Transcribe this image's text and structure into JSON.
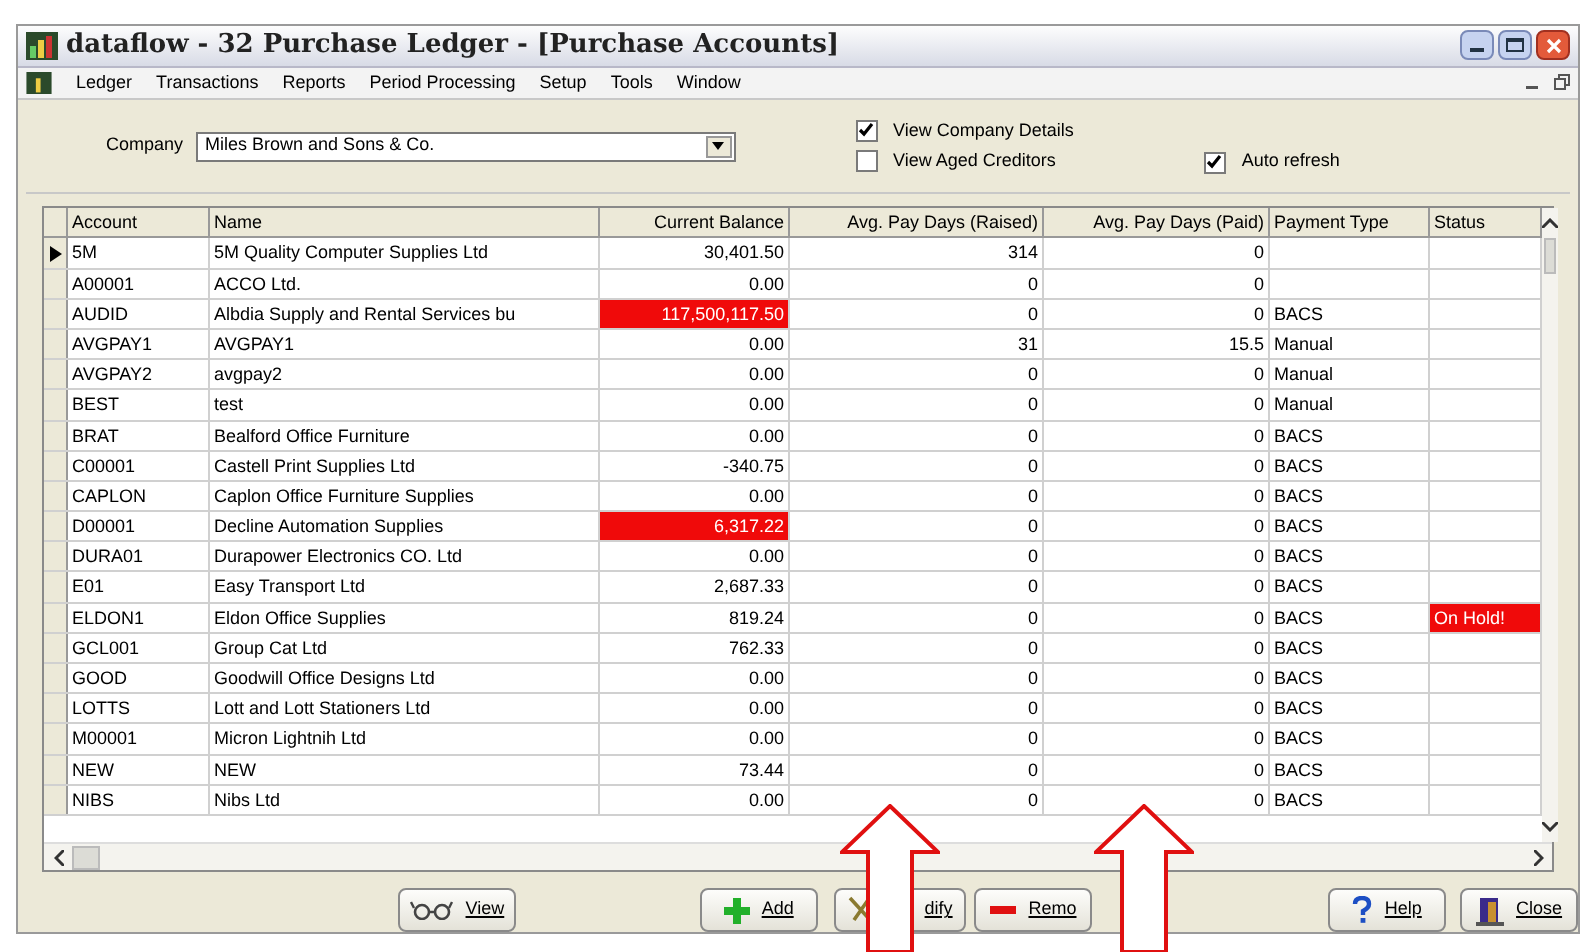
{
  "window": {
    "title": "dataflow - 32 Purchase Ledger - [Purchase Accounts]"
  },
  "menu": [
    "Ledger",
    "Transactions",
    "Reports",
    "Period Processing",
    "Setup",
    "Tools",
    "Window"
  ],
  "company": {
    "label": "Company",
    "value": "Miles Brown and Sons & Co."
  },
  "options": [
    {
      "label": "View Company Details",
      "checked": true
    },
    {
      "label": "View Aged Creditors",
      "checked": false
    },
    {
      "label": "Auto refresh",
      "checked": true
    }
  ],
  "table": {
    "columns": [
      "Account",
      "Name",
      "Current Balance",
      "Avg. Pay Days (Raised)",
      "Avg. Pay Days (Paid)",
      "Payment Type",
      "Status"
    ],
    "rows": [
      {
        "selected": true,
        "cells": [
          "5M",
          "5M Quality Computer Supplies Ltd",
          "30,401.50",
          "314",
          "0",
          "",
          ""
        ],
        "balance_alert": false,
        "status_alert": false
      },
      {
        "selected": false,
        "cells": [
          "A00001",
          "ACCO Ltd.",
          "0.00",
          "0",
          "0",
          "",
          ""
        ],
        "balance_alert": false,
        "status_alert": false
      },
      {
        "selected": false,
        "cells": [
          "AUDID",
          "Albdia Supply and Rental Services bu",
          "117,500,117.50",
          "0",
          "0",
          "BACS",
          ""
        ],
        "balance_alert": true,
        "status_alert": false
      },
      {
        "selected": false,
        "cells": [
          "AVGPAY1",
          "AVGPAY1",
          "0.00",
          "31",
          "15.5",
          "Manual",
          ""
        ],
        "balance_alert": false,
        "status_alert": false
      },
      {
        "selected": false,
        "cells": [
          "AVGPAY2",
          "avgpay2",
          "0.00",
          "0",
          "0",
          "Manual",
          ""
        ],
        "balance_alert": false,
        "status_alert": false
      },
      {
        "selected": false,
        "cells": [
          "BEST",
          "test",
          "0.00",
          "0",
          "0",
          "Manual",
          ""
        ],
        "balance_alert": false,
        "status_alert": false
      },
      {
        "selected": false,
        "cells": [
          "BRAT",
          "Bealford Office Furniture",
          "0.00",
          "0",
          "0",
          "BACS",
          ""
        ],
        "balance_alert": false,
        "status_alert": false
      },
      {
        "selected": false,
        "cells": [
          "C00001",
          "Castell Print Supplies Ltd",
          "-340.75",
          "0",
          "0",
          "BACS",
          ""
        ],
        "balance_alert": false,
        "status_alert": false
      },
      {
        "selected": false,
        "cells": [
          "CAPLON",
          "Caplon Office Furniture Supplies",
          "0.00",
          "0",
          "0",
          "BACS",
          ""
        ],
        "balance_alert": false,
        "status_alert": false
      },
      {
        "selected": false,
        "cells": [
          "D00001",
          "Decline Automation Supplies",
          "6,317.22",
          "0",
          "0",
          "BACS",
          ""
        ],
        "balance_alert": true,
        "status_alert": false
      },
      {
        "selected": false,
        "cells": [
          "DURA01",
          "Durapower Electronics CO. Ltd",
          "0.00",
          "0",
          "0",
          "BACS",
          ""
        ],
        "balance_alert": false,
        "status_alert": false
      },
      {
        "selected": false,
        "cells": [
          "E01",
          "Easy Transport Ltd",
          "2,687.33",
          "0",
          "0",
          "BACS",
          ""
        ],
        "balance_alert": false,
        "status_alert": false
      },
      {
        "selected": false,
        "cells": [
          "ELDON1",
          "Eldon Office Supplies",
          "819.24",
          "0",
          "0",
          "BACS",
          "On Hold!"
        ],
        "balance_alert": false,
        "status_alert": true
      },
      {
        "selected": false,
        "cells": [
          "GCL001",
          "Group Cat Ltd",
          "762.33",
          "0",
          "0",
          "BACS",
          ""
        ],
        "balance_alert": false,
        "status_alert": false
      },
      {
        "selected": false,
        "cells": [
          "GOOD",
          "Goodwill Office Designs Ltd",
          "0.00",
          "0",
          "0",
          "BACS",
          ""
        ],
        "balance_alert": false,
        "status_alert": false
      },
      {
        "selected": false,
        "cells": [
          "LOTTS",
          "Lott and Lott Stationers Ltd",
          "0.00",
          "0",
          "0",
          "BACS",
          ""
        ],
        "balance_alert": false,
        "status_alert": false
      },
      {
        "selected": false,
        "cells": [
          "M00001",
          "Micron Lightnih Ltd",
          "0.00",
          "0",
          "0",
          "BACS",
          ""
        ],
        "balance_alert": false,
        "status_alert": false
      },
      {
        "selected": false,
        "cells": [
          "NEW",
          "NEW",
          "73.44",
          "0",
          "0",
          "BACS",
          ""
        ],
        "balance_alert": false,
        "status_alert": false
      },
      {
        "selected": false,
        "cells": [
          "NIBS",
          "Nibs Ltd",
          "0.00",
          "0",
          "0",
          "BACS",
          ""
        ],
        "balance_alert": false,
        "status_alert": false
      }
    ]
  },
  "buttons": [
    {
      "kind": "view",
      "label": "View"
    },
    {
      "kind": "add",
      "label": "Add"
    },
    {
      "kind": "modify",
      "label": "dify"
    },
    {
      "kind": "remove",
      "label": "Remo"
    },
    {
      "kind": "help",
      "label": "Help"
    },
    {
      "kind": "close",
      "label": "Close"
    }
  ]
}
